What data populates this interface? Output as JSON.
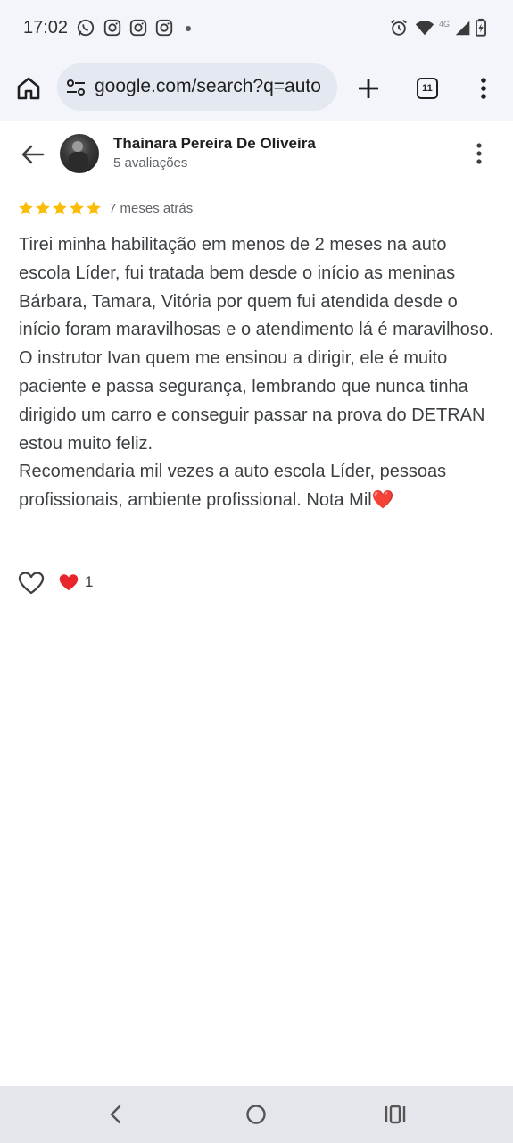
{
  "status_bar": {
    "time": "17:02",
    "network": "4G",
    "notification_icons": [
      "whatsapp-icon",
      "instagram-icon",
      "instagram-icon",
      "instagram-icon"
    ],
    "system_icons": [
      "alarm-icon",
      "wifi-icon",
      "cell-signal-icon",
      "battery-icon"
    ]
  },
  "browser": {
    "url": "google.com/search?q=auto",
    "tab_count": "11"
  },
  "review": {
    "author_name": "Thainara Pereira De Oliveira",
    "author_reviews": "5 avaliações",
    "rating": 5,
    "rating_max": 5,
    "date": "7 meses atrás",
    "paragraphs": [
      "Tirei minha habilitação em menos de 2 meses na auto escola Líder, fui tratada bem desde o início as meninas Bárbara, Tamara, Vitória por quem fui atendida desde o início foram maravilhosas e o atendimento lá é maravilhoso.",
      "O instrutor Ivan quem me ensinou a dirigir, ele é muito paciente e passa segurança, lembrando que nunca tinha dirigido um carro e conseguir passar na prova do DETRAN estou muito feliz.",
      "Recomendaria mil vezes a auto escola Líder, pessoas profissionais, ambiente profissional. Nota Mil❤️"
    ],
    "reaction_count": "1"
  },
  "colors": {
    "star": "#fbbc04",
    "heart": "#e8252b",
    "chrome_bg": "#f3f5fa",
    "nav_bg": "#e4e6eb"
  }
}
